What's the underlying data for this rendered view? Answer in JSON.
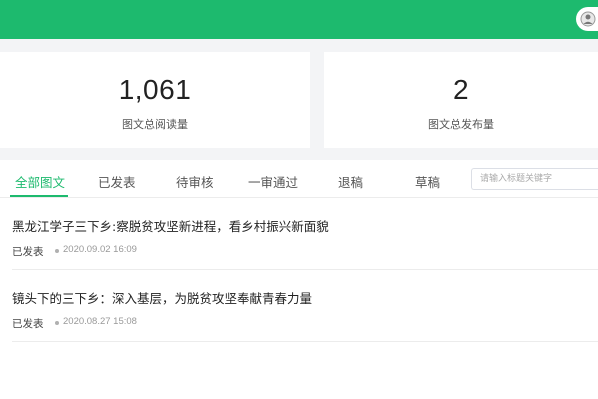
{
  "header": {
    "avatar_icon": "user-avatar-icon",
    "brand_color": "#1dba6e"
  },
  "stats": {
    "reads": {
      "value": "1,061",
      "label": "图文总阅读量"
    },
    "published": {
      "value": "2",
      "label": "图文总发布量"
    }
  },
  "tabs": [
    {
      "label": "全部图文",
      "active": true
    },
    {
      "label": "已发表",
      "active": false
    },
    {
      "label": "待审核",
      "active": false
    },
    {
      "label": "一审通过",
      "active": false
    },
    {
      "label": "退稿",
      "active": false
    },
    {
      "label": "草稿",
      "active": false
    }
  ],
  "search": {
    "placeholder": "请输入标题关键字",
    "value": ""
  },
  "articles": [
    {
      "title": "黑龙江学子三下乡:察脱贫攻坚新进程，看乡村振兴新面貌",
      "status": "已发表",
      "time": "2020.09.02 16:09"
    },
    {
      "title": "镜头下的三下乡：深入基层，为脱贫攻坚奉献青春力量",
      "status": "已发表",
      "time": "2020.08.27 15:08"
    }
  ]
}
